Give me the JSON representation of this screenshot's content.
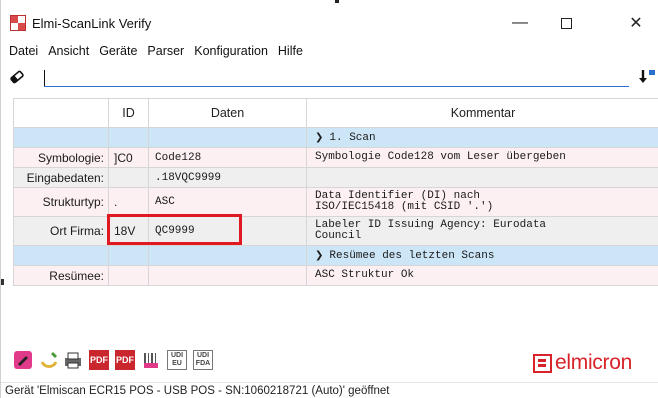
{
  "window": {
    "title": "Elmi-ScanLink Verify",
    "minimize_glyph": "—",
    "close_glyph": "✕"
  },
  "menu": [
    "Datei",
    "Ansicht",
    "Geräte",
    "Parser",
    "Konfiguration",
    "Hilfe"
  ],
  "command_input": {
    "value": ""
  },
  "table": {
    "headers": [
      "",
      "ID",
      "Daten",
      "Kommentar"
    ],
    "group1": "1. Scan",
    "rows": [
      {
        "label": "Symbologie:",
        "id": "]C0",
        "data": "Code128",
        "comment": "Symbologie Code128 vom Leser übergeben"
      },
      {
        "label": "Eingabedaten:",
        "id": "",
        "data": ".18VQC9999",
        "comment": ""
      },
      {
        "label": "Strukturtyp:",
        "id": ".",
        "data": "ASC",
        "comment_l1": "Data Identifier (DI) nach",
        "comment_l2": "ISO/IEC15418 (mit CSID '.')"
      },
      {
        "label": "Ort Firma:",
        "id": "18V",
        "data": "QC9999",
        "comment_l1": "Labeler ID Issuing Agency: Eurodata",
        "comment_l2": "Council"
      }
    ],
    "group2": "Resümee des letzten Scans",
    "summary": {
      "label": "Resümee:",
      "id": "",
      "data": "",
      "comment": "ASC Struktur Ok"
    }
  },
  "toolbar": {
    "icons": [
      "edit-icon",
      "clear-icon",
      "print-icon",
      "pdf-icon",
      "pdf-export-icon",
      "gs1-icon",
      "udi-eu-icon",
      "udi-fda-icon"
    ],
    "pdf_label": "PDF",
    "udi_eu_l1": "UDI",
    "udi_eu_l2": "EU",
    "udi_fda_l1": "UDI",
    "udi_fda_l2": "FDA"
  },
  "brand": {
    "name": "elmicron",
    "color": "#d8232a"
  },
  "status": "Gerät 'Elmiscan ECR15 POS - USB POS - SN:1060218721 (Auto)' geöffnet",
  "colors": {
    "group_row": "#cde6f7",
    "pink_row": "#fdf0f3",
    "highlight": "#e01822",
    "input_underline": "#2a6fc9"
  }
}
